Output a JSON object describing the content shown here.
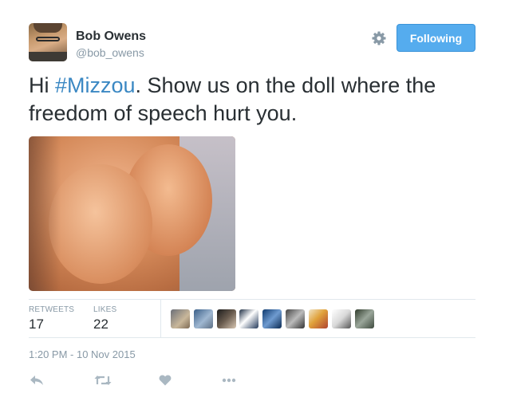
{
  "author": {
    "name": "Bob Owens",
    "handle": "@bob_owens"
  },
  "follow_button": {
    "label": "Following"
  },
  "tweet": {
    "text_prefix": "Hi ",
    "hashtag": "#Mizzou",
    "text_suffix": ". Show us on the doll where the freedom of speech hurt you."
  },
  "stats": {
    "retweets_label": "RETWEETS",
    "retweets_count": "17",
    "likes_label": "LIKES",
    "likes_count": "22"
  },
  "timestamp": "1:20 PM - 10 Nov 2015",
  "actions": {
    "reply_icon": "reply-icon",
    "retweet_icon": "retweet-icon",
    "like_icon": "heart-icon",
    "more_icon": "more-dots-icon"
  },
  "colors": {
    "accent": "#55acee",
    "hashtag": "#3b88c3",
    "muted": "#8899a6",
    "text": "#292f33"
  }
}
